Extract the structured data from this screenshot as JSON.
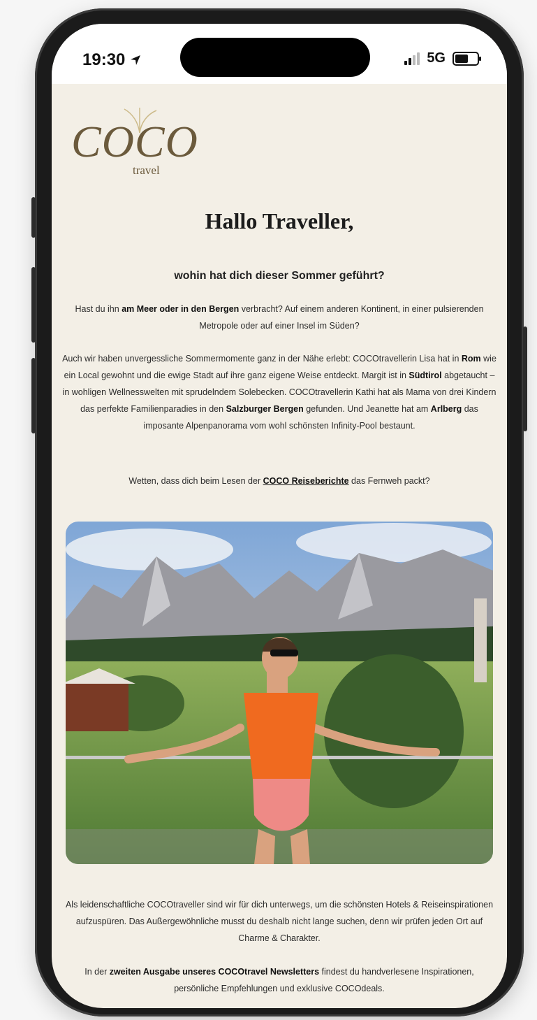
{
  "status_bar": {
    "time": "19:30",
    "network": "5G"
  },
  "logo": {
    "main": "COCO",
    "sub": "travel"
  },
  "newsletter": {
    "greeting": "Hallo Traveller,",
    "subheadline": "wohin hat dich dieser Sommer geführt?",
    "p1": {
      "t1": "Hast du ihn ",
      "b1": "am Meer oder in den Bergen",
      "t2": " verbracht? Auf einem anderen Kontinent, in einer pulsierenden Metropole oder auf einer Insel im Süden?"
    },
    "p2": {
      "t1": "Auch wir haben unvergessliche Sommermomente ganz in der Nähe erlebt: COCOtravellerin Lisa hat in ",
      "b1": "Rom",
      "t2": " wie ein Local gewohnt und die ewige Stadt auf ihre ganz eigene Weise entdeckt. Margit ist in ",
      "b2": "Südtirol",
      "t3": " abgetaucht – in wohligen Wellnesswelten mit sprudelndem Solebecken. COCOtravellerin Kathi hat als Mama von drei Kindern das perfekte Familienparadies in den ",
      "b3": "Salzburger Bergen",
      "t4": " gefunden. Und Jeanette hat am ",
      "b4": "Arlberg",
      "t5": " das imposante Alpenpanorama vom wohl schönsten Infinity-Pool bestaunt."
    },
    "p3": {
      "t1": "Wetten, dass dich beim Lesen der ",
      "link": "COCO Reiseberichte",
      "t2": " das Fernweh packt?"
    },
    "p4": {
      "t1": "Als leidenschaftliche COCOtraveller sind wir für dich unterwegs, um die schönsten Hotels & Reiseinspirationen aufzuspüren. Das Außergewöhnliche musst du deshalb nicht lange suchen, denn wir prüfen jeden Ort auf Charme & Charakter."
    },
    "p5": {
      "t1": "In der ",
      "b1": "zweiten Ausgabe unseres COCOtravel Newsletters",
      "t2": " findest du handverlesene Inspirationen, persönliche Empfehlungen und exklusive COCOdeals."
    }
  },
  "colors": {
    "background": "#f3efe6",
    "logo": "#6b5a3c",
    "swimsuit_top": "#f06a1f",
    "swimsuit_bottom": "#ee8a86"
  }
}
